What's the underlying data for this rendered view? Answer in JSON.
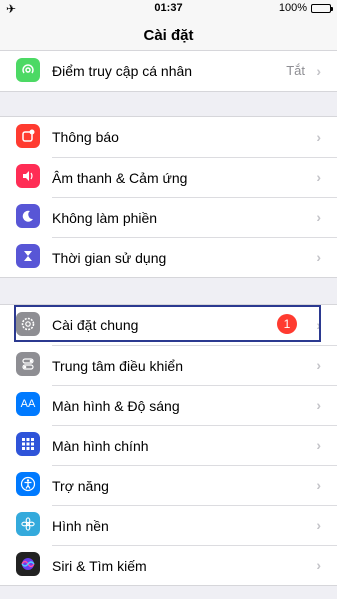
{
  "status": {
    "time": "01:37",
    "battery": "100%",
    "left_icon": "✈"
  },
  "nav": {
    "title": "Cài đặt"
  },
  "group0": [
    {
      "label": "Điểm truy cập cá nhân",
      "value": "Tắt",
      "icon": "hotspot-icon",
      "color": "#4cd964"
    }
  ],
  "group1": [
    {
      "label": "Thông báo",
      "icon": "notifications-icon",
      "color": "#ff3b30"
    },
    {
      "label": "Âm thanh & Cảm ứng",
      "icon": "sound-icon",
      "color": "#ff2d55"
    },
    {
      "label": "Không làm phiền",
      "icon": "moon-icon",
      "color": "#5856d6"
    },
    {
      "label": "Thời gian sử dụng",
      "icon": "hourglass-icon",
      "color": "#5856d6"
    }
  ],
  "group2": [
    {
      "label": "Cài đặt chung",
      "badge": "1",
      "icon": "gear-icon",
      "color": "#8e8e93"
    },
    {
      "label": "Trung tâm điều khiển",
      "icon": "control-center-icon",
      "color": "#8e8e93"
    },
    {
      "label": "Màn hình & Độ sáng",
      "icon": "display-icon",
      "color": "#007aff"
    },
    {
      "label": "Màn hình chính",
      "icon": "home-screen-icon",
      "color": "#2f54d9"
    },
    {
      "label": "Trợ năng",
      "icon": "accessibility-icon",
      "color": "#007aff"
    },
    {
      "label": "Hình nền",
      "icon": "wallpaper-icon",
      "color": "#34aadc"
    },
    {
      "label": "Siri & Tìm kiếm",
      "icon": "siri-icon",
      "color": "#222"
    }
  ]
}
